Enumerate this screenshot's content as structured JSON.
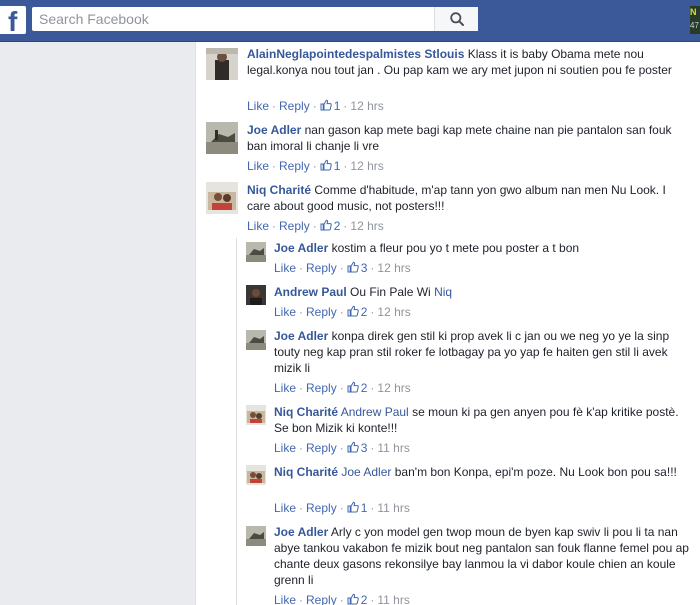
{
  "search": {
    "placeholder": "Search Facebook"
  },
  "corner": {
    "line1": "N",
    "line2": "47"
  },
  "actions": {
    "like": "Like",
    "reply": "Reply",
    "dot": "·"
  },
  "comments": [
    {
      "author": "AlainNeglapointedespalmistes Stlouis",
      "mention": "",
      "text": "Klass it is baby Obama mete nou legal.konya nou tout jan . Ou pap kam we ary met jupon ni soutien pou fe poster",
      "likes": "1",
      "time": "12 hrs"
    },
    {
      "author": "Joe Adler",
      "mention": "",
      "text": "nan gason kap mete bagi kap mete chaine nan pie pantalon san fouk ban imoral li chanje li vre",
      "likes": "1",
      "time": "12 hrs"
    },
    {
      "author": "Niq Charité",
      "mention": "",
      "text": "Comme d'habitude, m'ap tann yon gwo album nan men Nu Look. I care about good music, not posters!!!",
      "likes": "2",
      "time": "12 hrs"
    }
  ],
  "replies": [
    {
      "author": "Joe Adler",
      "mention": "",
      "text": "kostim a fleur pou yo t mete pou poster a t bon",
      "likes": "3",
      "time": "12 hrs"
    },
    {
      "author": "Andrew Paul",
      "mention": "",
      "text": "Ou Fin Pale Wi",
      "tail_tag": "Niq",
      "likes": "2",
      "time": "12 hrs"
    },
    {
      "author": "Joe Adler",
      "mention": "",
      "text": "konpa direk gen stil ki prop avek li c jan ou we neg yo ye la sinp touty neg kap pran stil roker fe lotbagay pa yo yap fe haiten gen stil li avek mizik li",
      "likes": "2",
      "time": "12 hrs"
    },
    {
      "author": "Niq Charité",
      "mention": "Andrew Paul",
      "text": "se moun ki pa gen anyen pou fè k'ap kritike postè. Se bon Mizik ki konte!!!",
      "likes": "3",
      "time": "11 hrs"
    },
    {
      "author": "Niq Charité",
      "mention": "Joe Adler",
      "text": "ban'm bon Konpa, epi'm poze. Nu Look bon pou sa!!!",
      "likes": "1",
      "time": "11 hrs"
    },
    {
      "author": "Joe Adler",
      "mention": "",
      "text": "Arly c yon model gen twop moun de byen kap swiv li pou li ta nan abye tankou vakabon fe mizik bout neg pantalon san fouk flanne femel pou ap chante deux gasons rekonsilye bay lanmou la vi dabor koule chien an koule grenn li",
      "likes": "2",
      "time": "11 hrs"
    }
  ]
}
